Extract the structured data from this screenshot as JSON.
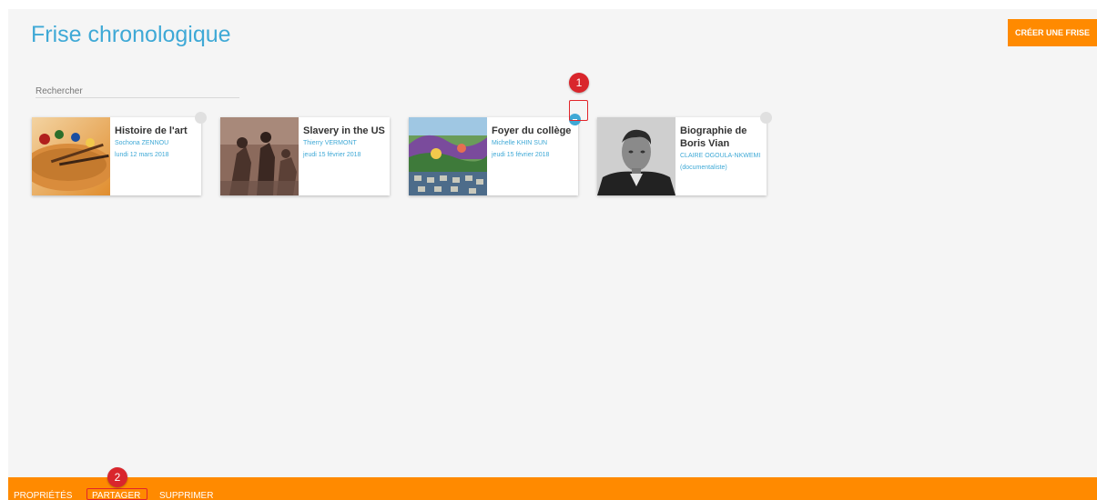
{
  "header": {
    "title": "Frise chronologique",
    "create_label": "CRÉER UNE FRISE"
  },
  "search": {
    "placeholder": "Rechercher"
  },
  "cards": [
    {
      "title": "Histoire de l'art",
      "author": "Sochona ZENNOU",
      "date": "lundi 12 mars 2018",
      "image": "painting-palette"
    },
    {
      "title": "Slavery in the US",
      "author": "Thierry VERMONT",
      "date": "jeudi 15 février 2018",
      "image": "historical-engraving"
    },
    {
      "title": "Foyer du collège",
      "author": "Michelle KHIN SUN",
      "date": "jeudi 15 février 2018",
      "image": "painted-mural"
    },
    {
      "title": "Biographie de Boris Vian",
      "author": "CLAIRE OGOULA-NKWEMI (documentaliste)",
      "date": "",
      "image": "portrait-photo"
    }
  ],
  "annotations": {
    "marker_1": "1",
    "marker_2": "2"
  },
  "bottom_bar": {
    "properties_label": "PROPRIÉTÉS",
    "share_label": "PARTAGER",
    "delete_label": "SUPPRIMER"
  },
  "colors": {
    "accent_blue": "#3fa9d6",
    "orange": "#ff8a00",
    "highlight_red": "#e2252b",
    "marker_red": "#d9262c"
  }
}
